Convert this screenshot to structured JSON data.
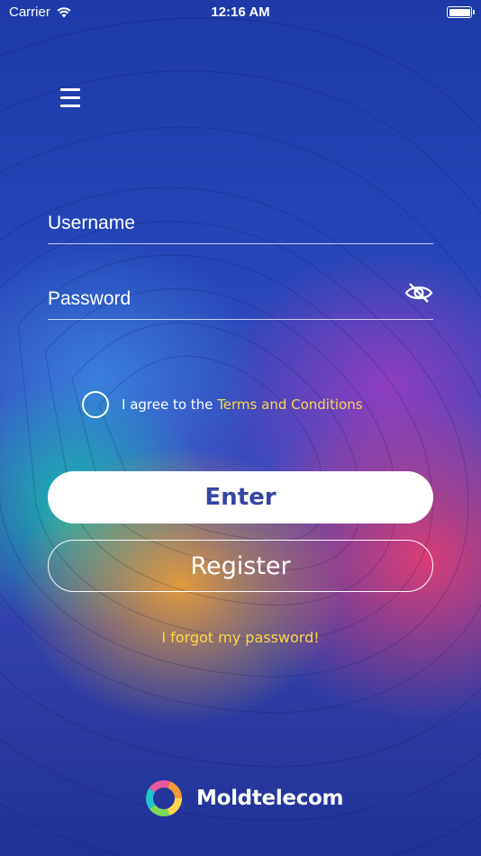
{
  "status_bar": {
    "carrier": "Carrier",
    "time": "12:16 AM",
    "battery_level": 1.0
  },
  "icons": {
    "menu": "hamburger-menu-icon",
    "password_visibility": "eye-slash-icon",
    "wifi": "wifi-icon"
  },
  "form": {
    "username_placeholder": "Username",
    "username_value": "",
    "password_placeholder": "Password",
    "password_value": ""
  },
  "agreement": {
    "prefix": "I agree to the ",
    "link": "Terms and Conditions",
    "checked": false
  },
  "buttons": {
    "enter": "Enter",
    "register": "Register"
  },
  "forgot_link": "I forgot my password!",
  "brand": {
    "name": "Moldtelecom"
  },
  "colors": {
    "accent_yellow": "#ffd84a",
    "enter_text": "#3745a6",
    "background_top": "#1d3aa8"
  }
}
